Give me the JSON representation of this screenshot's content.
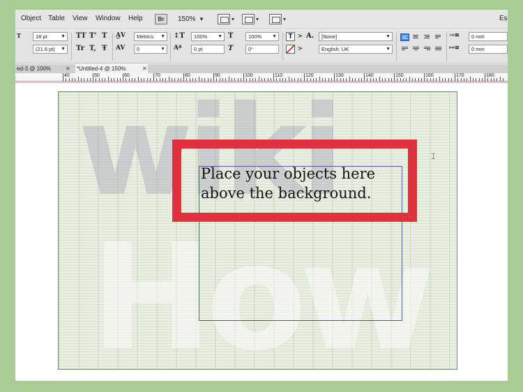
{
  "menubar": {
    "items": [
      "Object",
      "Table",
      "View",
      "Window",
      "Help"
    ],
    "bridge_label": "Br",
    "zoom": "150%",
    "workspace": "Ess"
  },
  "control_panel": {
    "font_size": "18 pt",
    "leading": "(21.6 pt)",
    "kerning": "Metrics",
    "tracking": "0",
    "vertical_scale": "100%",
    "baseline_shift": "0 pt",
    "horizontal_scale": "100%",
    "skew": "0°",
    "char_style": "[None]",
    "language": "English: UK",
    "indent_left": "0 mm",
    "indent_right": "0 mm",
    "caps_labels": [
      "TT",
      "T'",
      "T",
      "Tr",
      "T,",
      "Ŧ"
    ]
  },
  "tabs": [
    {
      "label": "ed-3 @ 100%",
      "active": false
    },
    {
      "label": "*Untitled-4 @ 150%",
      "active": true
    }
  ],
  "ruler": {
    "labels": [
      "40",
      "50",
      "60",
      "70",
      "80",
      "90",
      "100",
      "110",
      "120",
      "130",
      "140",
      "150",
      "160",
      "170",
      "180"
    ]
  },
  "document": {
    "text_line1": "Place your objects here",
    "text_line2": "above the background.",
    "highlight_color": "#e0323e",
    "background_word_top": "wiki",
    "background_word_bottom": "How"
  },
  "colors": {
    "outer_background": "#a9cc94",
    "selected_align": "#3d7fd9"
  }
}
